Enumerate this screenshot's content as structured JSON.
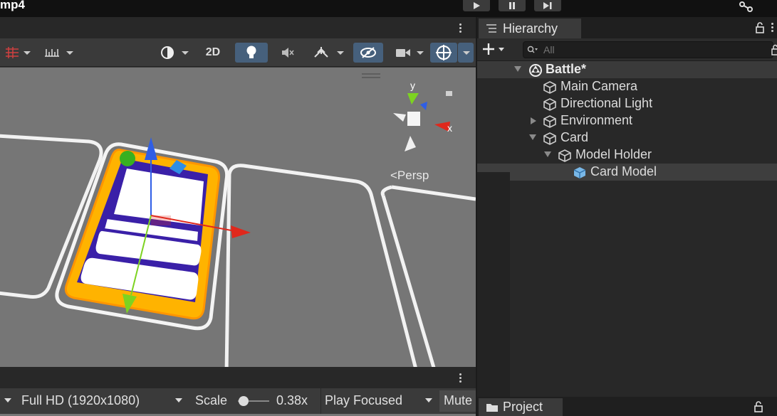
{
  "video_title": "mp4",
  "playmode": {
    "play": "play-icon",
    "pause": "pause-icon",
    "step": "step-icon"
  },
  "scene_toolbar": {
    "view_2d_label": "2D"
  },
  "scene_view": {
    "persp_label": "<Persp",
    "gizmo_axes": {
      "y": "y",
      "x": "x"
    }
  },
  "game_toolbar": {
    "resolution": "Full HD (1920x1080)",
    "scale_label": "Scale",
    "scale_value": "0.38x",
    "scale_slider": 0.12,
    "play_mode": "Play Focused",
    "mute_label": "Mute"
  },
  "hierarchy": {
    "tab_label": "Hierarchy",
    "search_placeholder": "All",
    "items": [
      {
        "label": "Battle*",
        "type": "scene",
        "expanded": true
      },
      {
        "label": "Main Camera",
        "type": "gameobject"
      },
      {
        "label": "Directional Light",
        "type": "gameobject"
      },
      {
        "label": "Environment",
        "type": "gameobject",
        "expanded": false
      },
      {
        "label": "Card",
        "type": "gameobject",
        "expanded": true
      },
      {
        "label": "Model Holder",
        "type": "gameobject",
        "expanded": true
      },
      {
        "label": "Card Model",
        "type": "prefab",
        "selected": true
      }
    ]
  },
  "project": {
    "tab_label": "Project"
  },
  "colors": {
    "accent_on": "#46607c",
    "axis_x": "#e0281c",
    "axis_y": "#7dd321",
    "axis_z": "#2f5ee6",
    "card_border": "#ffb300",
    "card_inner": "#3a20a8"
  }
}
